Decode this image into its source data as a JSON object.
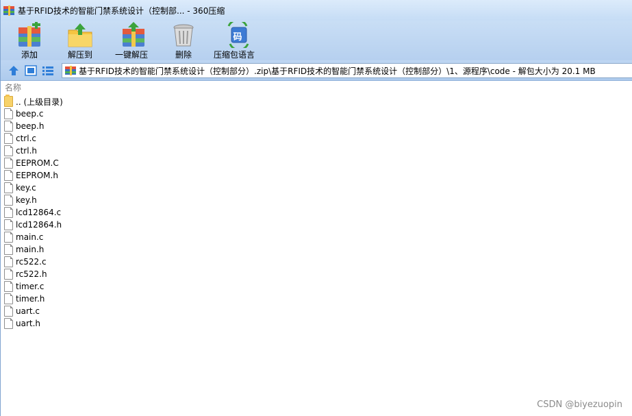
{
  "window": {
    "title": "基于RFID技术的智能门禁系统设计（控制部... - 360压缩"
  },
  "toolbar": {
    "buttons": [
      {
        "label": "添加",
        "icon": "add-archive-icon"
      },
      {
        "label": "解压到",
        "icon": "extract-to-icon"
      },
      {
        "label": "一键解压",
        "icon": "one-click-extract-icon"
      },
      {
        "label": "删除",
        "icon": "delete-icon"
      },
      {
        "label": "压缩包语言",
        "icon": "archive-encoding-icon",
        "glyph": "码"
      }
    ]
  },
  "address_bar": {
    "path": "基于RFID技术的智能门禁系统设计（控制部分）.zip\\基于RFID技术的智能门禁系统设计（控制部分）\\1、源程序\\code - 解包大小为 20.1 MB"
  },
  "file_list": {
    "column_header": "名称",
    "items": [
      {
        "name": ".. (上级目录)",
        "type": "folder"
      },
      {
        "name": "beep.c",
        "type": "file"
      },
      {
        "name": "beep.h",
        "type": "file"
      },
      {
        "name": "ctrl.c",
        "type": "file"
      },
      {
        "name": "ctrl.h",
        "type": "file"
      },
      {
        "name": "EEPROM.C",
        "type": "file"
      },
      {
        "name": "EEPROM.h",
        "type": "file"
      },
      {
        "name": "key.c",
        "type": "file"
      },
      {
        "name": "key.h",
        "type": "file"
      },
      {
        "name": "lcd12864.c",
        "type": "file"
      },
      {
        "name": "lcd12864.h",
        "type": "file"
      },
      {
        "name": "main.c",
        "type": "file"
      },
      {
        "name": "main.h",
        "type": "file"
      },
      {
        "name": "rc522.c",
        "type": "file"
      },
      {
        "name": "rc522.h",
        "type": "file"
      },
      {
        "name": "timer.c",
        "type": "file"
      },
      {
        "name": "timer.h",
        "type": "file"
      },
      {
        "name": "uart.c",
        "type": "file"
      },
      {
        "name": "uart.h",
        "type": "file"
      }
    ]
  },
  "watermark": "CSDN @biyezuopin",
  "colors": {
    "toolbar_bg": "#c9def5",
    "addr_bar_bg": "#bed6f2",
    "folder": "#f7d26a",
    "header_text": "#7d7d7d"
  }
}
